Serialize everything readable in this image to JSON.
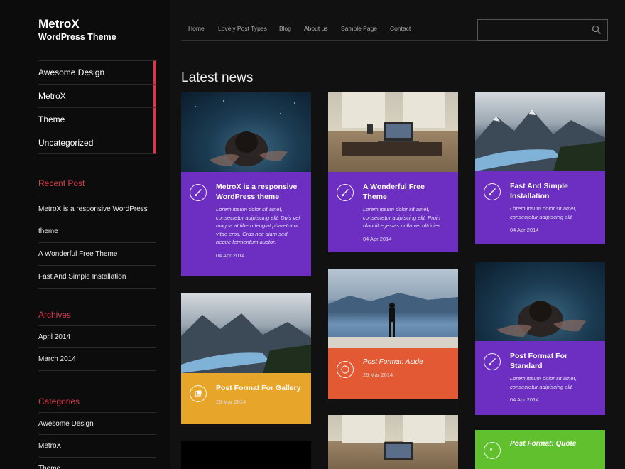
{
  "site": {
    "title": "MetroX",
    "subtitle": "WordPress Theme"
  },
  "nav": {
    "links": [
      "Home",
      "Lovely Post Types",
      "Blog",
      "About us",
      "Sample Page",
      "Contact"
    ],
    "search_placeholder": ""
  },
  "sidebar": {
    "categories_nav": [
      "Awesome Design",
      "MetroX",
      "Theme",
      "Uncategorized"
    ],
    "recent_post": {
      "title": "Recent Post",
      "items": [
        "MetroX is a responsive WordPress",
        "theme",
        "A Wonderful Free Theme",
        "Fast And Simple Installation"
      ]
    },
    "archives": {
      "title": "Archives",
      "items": [
        "April 2014",
        "March 2014"
      ]
    },
    "categories": {
      "title": "Categories",
      "items": [
        "Awesome Design",
        "MetroX",
        "Theme"
      ]
    }
  },
  "main": {
    "section_title": "Latest news",
    "cards": [
      {
        "title": "MetroX is a responsive WordPress theme",
        "excerpt": "Lorem ipsum dolor sit amet, consectetur adipiscing elit. Duis vel magna at libero feugiat pharetra ut vitae eros. Cras nec diam sed neque fermentum auctor.",
        "date": "04 Apr 2014",
        "color": "#6c2fc2",
        "icon": "brush-icon",
        "image": "underwater-swimmer"
      },
      {
        "title": "A Wonderful Free Theme",
        "excerpt": "Lorem ipsum dolor sit amet, consectetur adipiscing elit. Proin blandit egestas nulla vel ultricies.",
        "date": "04 Apr 2014",
        "color": "#6c2fc2",
        "icon": "brush-icon",
        "image": "laptop-desk"
      },
      {
        "title": "Fast And Simple Installation",
        "excerpt": "Lorem ipsum dolor sit amet, consectetur adipiscing elit.",
        "date": "04 Apr 2014",
        "color": "#6c2fc2",
        "icon": "brush-icon",
        "image": "mountain-lake"
      },
      {
        "title": "Post Format For Gallery",
        "excerpt": "",
        "date": "26 Mar 2014",
        "color": "#e7a52a",
        "icon": "gallery-icon",
        "image": "mountain-lake"
      },
      {
        "title": "Post Format: Aside",
        "excerpt": "",
        "date": "26 Mar 2014",
        "color": "#e35934",
        "icon": "aside-icon",
        "image": "man-by-lake"
      },
      {
        "title": "Post Format For Standard",
        "excerpt": "Lorem ipsum dolor sit amet, consectetur adipiscing elit.",
        "date": "04 Apr 2014",
        "color": "#6c2fc2",
        "icon": "brush-icon",
        "image": "underwater-swimmer"
      },
      {
        "title": "Post Format: Quote",
        "excerpt": "",
        "date": "",
        "color": "#61c02e",
        "icon": "quote-icon",
        "image": ""
      }
    ]
  }
}
